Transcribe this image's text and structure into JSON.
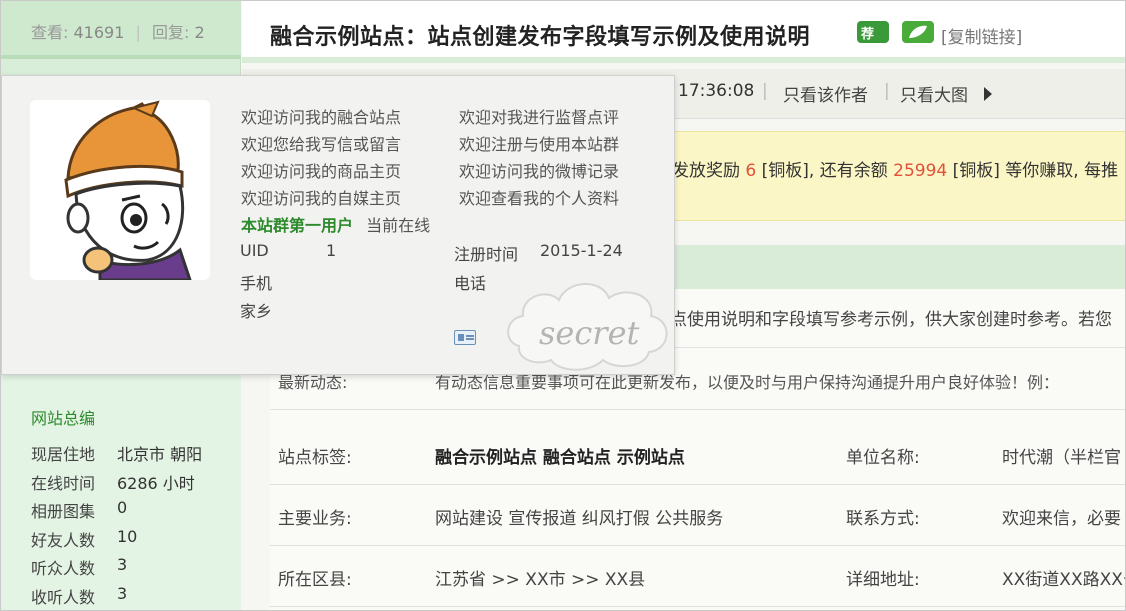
{
  "stats": {
    "views_label": "查看:",
    "views": "41691",
    "replies_label": "回复:",
    "replies": "2"
  },
  "thread": {
    "title": "融合示例站点：站点创建发布字段填写示例及使用说明",
    "badge_rec": "荐",
    "copy_link": "[复制链接]",
    "time": "17:36:08",
    "only_author": "只看该作者",
    "only_images": "只看大图"
  },
  "notice": {
    "pre": "发放奖励",
    "reward": "6",
    "unit1": "[铜板], 还有余额",
    "balance": "25994",
    "unit2": "[铜板] 等你赚取, 每推"
  },
  "content": {
    "intro": "点使用说明和字段填写参考示例，供大家创建时参考。若您",
    "news_label": "最新动态:",
    "news_text": "有动态信息重要事项可在此更新发布，以便及时与用户保持沟通提升用户良好体验！例："
  },
  "fields": [
    {
      "label": "站点标签:",
      "value": "融合示例站点 融合站点 示例站点",
      "label2": "单位名称:",
      "value2": "时代潮（半栏官"
    },
    {
      "label": "主要业务:",
      "value": "网站建设 宣传报道 纠风打假 公共服务",
      "label2": "联系方式:",
      "value2": "欢迎来信，必要"
    },
    {
      "label": "所在区县:",
      "value": "江苏省 >> XX市 >> XX县",
      "label2": "详细地址:",
      "value2": "XX街道XX路XX号"
    }
  ],
  "popup": {
    "links": [
      [
        "欢迎访问我的融合站点",
        "欢迎对我进行监督点评"
      ],
      [
        "欢迎您给我写信或留言",
        "欢迎注册与使用本站群"
      ],
      [
        "欢迎访问我的商品主页",
        "欢迎访问我的微博记录"
      ],
      [
        "欢迎访问我的自媒主页",
        "欢迎查看我的个人资料"
      ]
    ],
    "user_name": "本站群第一用户",
    "user_status": "当前在线",
    "uid_label": "UID",
    "uid": "1",
    "reg_label": "注册时间",
    "reg": "2015-1-24",
    "mobile_label": "手机",
    "phone_label": "电话",
    "hometown_label": "家乡",
    "watermark": "secret"
  },
  "sidebar": {
    "section_title": "网站总编",
    "rows": [
      {
        "k": "现居住地",
        "v": "北京市 朝阳"
      },
      {
        "k": "在线时间",
        "v": "6286 小时"
      },
      {
        "k": "相册图集",
        "v": "0"
      },
      {
        "k": "好友人数",
        "v": "10"
      },
      {
        "k": "听众人数",
        "v": "3"
      },
      {
        "k": "收听人数",
        "v": "3"
      }
    ]
  },
  "colors": {
    "accent_green": "#2d8a2d",
    "reward_red": "#e0503a",
    "notice_bg": "#fbf6c6",
    "sidebar_bg": "#d8eed8"
  }
}
